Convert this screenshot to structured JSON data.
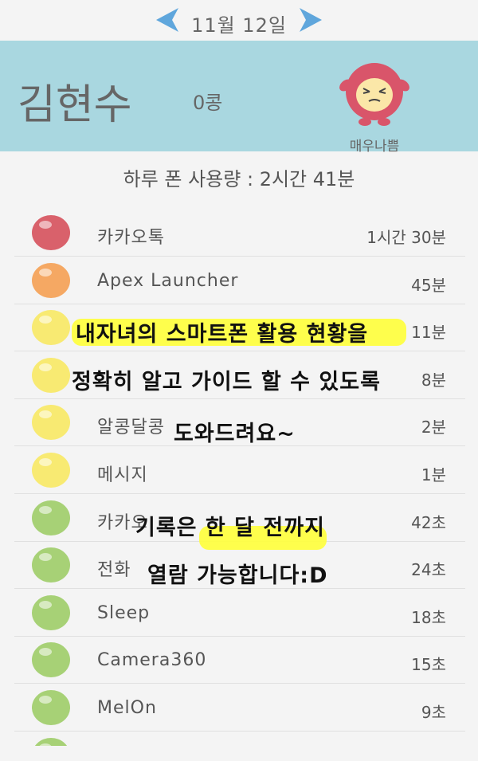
{
  "date_nav": {
    "date": "11월  12일"
  },
  "profile": {
    "name": "김현수",
    "points": "0콩",
    "mood_label": "매우나쁨"
  },
  "usage_total": "하루 폰 사용량 : 2시간 41분",
  "apps": [
    {
      "name": "카카오톡",
      "duration": "1시간 30분",
      "color": "#d9616b"
    },
    {
      "name": "Apex Launcher",
      "duration": "45분",
      "color": "#f5a863"
    },
    {
      "name": "",
      "duration": "11분",
      "color": "#f8ea72"
    },
    {
      "name": "",
      "duration": "8분",
      "color": "#f8ea72"
    },
    {
      "name": "알콩달콩",
      "duration": "2분",
      "color": "#f8ea72"
    },
    {
      "name": "메시지",
      "duration": "1분",
      "color": "#f8ea72"
    },
    {
      "name": "카카오",
      "duration": "42초",
      "color": "#a7d176"
    },
    {
      "name": "전화",
      "duration": "24초",
      "color": "#a7d176"
    },
    {
      "name": "Sleep",
      "duration": "18초",
      "color": "#a7d176"
    },
    {
      "name": "Camera360",
      "duration": "15초",
      "color": "#a7d176"
    },
    {
      "name": "MelOn",
      "duration": "9초",
      "color": "#a7d176"
    }
  ],
  "overlay": {
    "line1": "내자녀의 스마트폰 활용 현황을",
    "line2": "정확히 알고 가이드 할 수 있도록",
    "line3": "도와드려요~",
    "line4": "기록은 한 달 전까지",
    "line5": "열람 가능합니다:D"
  }
}
